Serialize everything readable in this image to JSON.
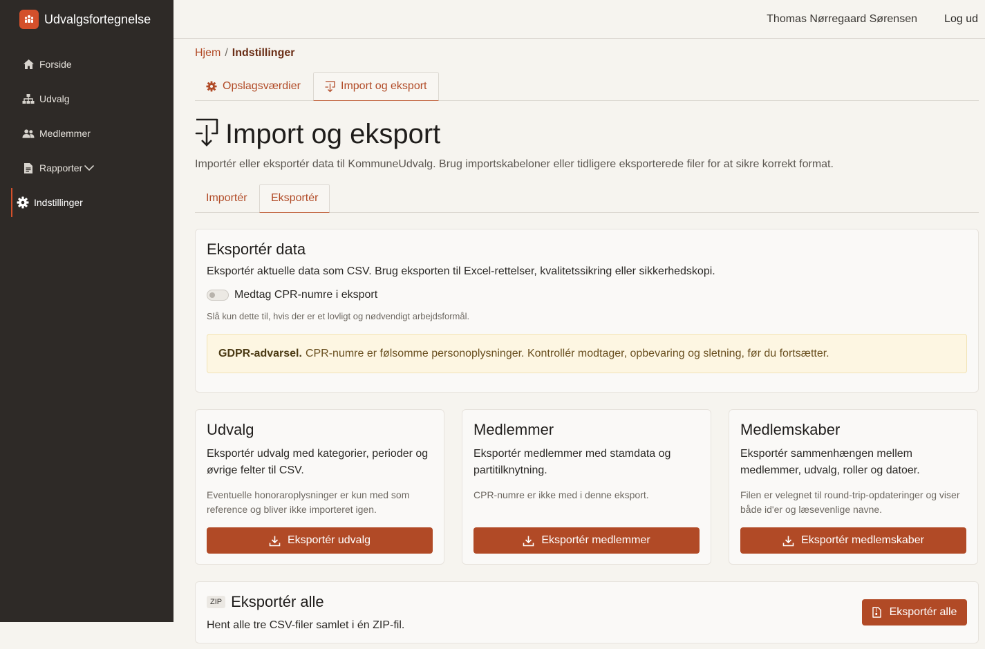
{
  "app": {
    "name": "Udvalgsfortegnelse"
  },
  "topbar": {
    "user": "Thomas Nørregaard Sørensen",
    "logout": "Log ud"
  },
  "sidebar": {
    "items": [
      {
        "label": "Forside",
        "icon": "home-icon"
      },
      {
        "label": "Udvalg",
        "icon": "sitemap-icon"
      },
      {
        "label": "Medlemmer",
        "icon": "users-icon"
      },
      {
        "label": "Rapporter",
        "icon": "document-icon"
      },
      {
        "label": "Indstillinger",
        "icon": "gear-icon",
        "active": true
      }
    ]
  },
  "breadcrumb": {
    "home": "Hjem",
    "separator": "/",
    "current": "Indstillinger"
  },
  "settings_tabs": [
    {
      "label": "Opslagsværdier",
      "icon": "gear-icon"
    },
    {
      "label": "Import og eksport",
      "icon": "import-icon",
      "active": true
    }
  ],
  "page": {
    "title": "Import og eksport",
    "description": "Importér eller eksportér data til KommuneUdvalg. Brug importskabeloner eller tidligere eksporterede filer for at sikre korrekt format."
  },
  "io_tabs": [
    {
      "label": "Importér"
    },
    {
      "label": "Eksportér",
      "active": true
    }
  ],
  "export_data": {
    "title": "Eksportér data",
    "description": "Eksportér aktuelle data som CSV. Brug eksporten til Excel-rettelser, kvalitetssikring eller sikkerhedskopi.",
    "toggle_label": "Medtag CPR-numre i eksport",
    "toggle_on": false,
    "hint": "Slå kun dette til, hvis der er et lovligt og nødvendigt arbejdsformål.",
    "alert_title": "GDPR-advarsel.",
    "alert_text": "CPR-numre er følsomme personoplysninger. Kontrollér modtager, opbevaring og sletning, før du fortsætter."
  },
  "cards": [
    {
      "title": "Udvalg",
      "description": "Eksportér udvalg med kategorier, perioder og øvrige felter til CSV.",
      "note": "Eventuelle honoraroplysninger er kun med som reference og bliver ikke importeret igen.",
      "button": "Eksportér udvalg"
    },
    {
      "title": "Medlemmer",
      "description": "Eksportér medlemmer med stamdata og partitilknytning.",
      "note": "CPR-numre er ikke med i denne eksport.",
      "button": "Eksportér medlemmer"
    },
    {
      "title": "Medlemskaber",
      "description": "Eksportér sammenhængen mellem medlemmer, udvalg, roller og datoer.",
      "note": "Filen er velegnet til round-trip-opdateringer og viser både id'er og læsevenlige navne.",
      "button": "Eksportér medlemskaber"
    }
  ],
  "export_all": {
    "badge": "ZIP",
    "title": "Eksportér alle",
    "description": "Hent alle tre CSV-filer samlet i én ZIP-fil.",
    "button": "Eksportér alle"
  },
  "colors": {
    "accent": "#b14a26",
    "sidebar": "#2e2a27",
    "brand": "#d4502b",
    "alert_bg": "#fdf6e2"
  }
}
